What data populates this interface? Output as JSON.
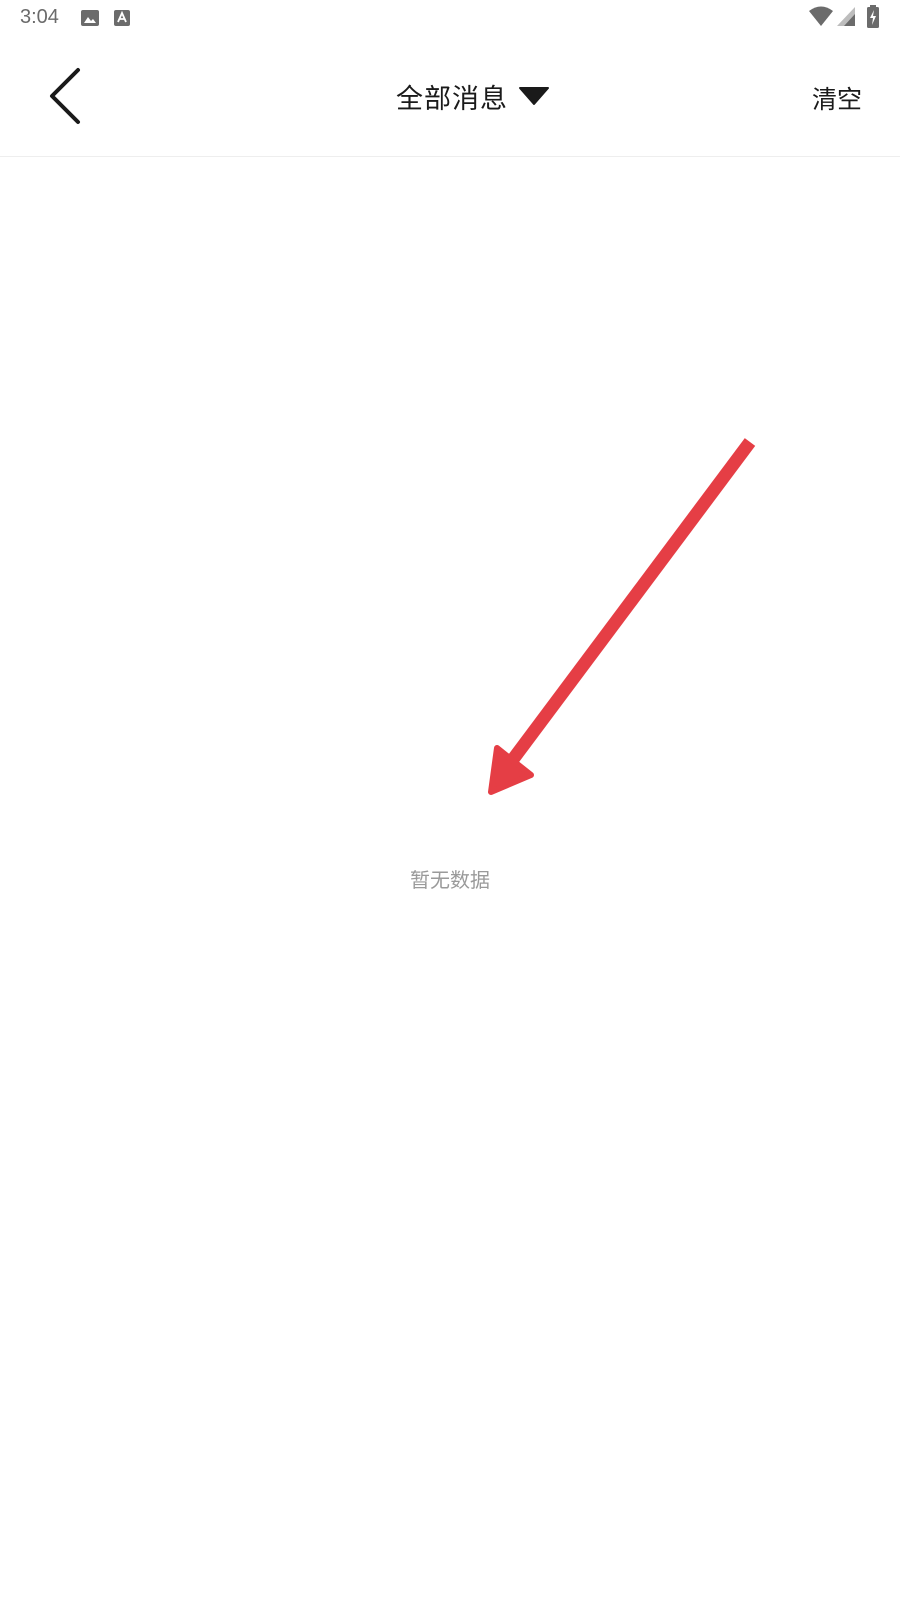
{
  "status_bar": {
    "time": "3:04",
    "icons": [
      "image-notification-icon",
      "text-notification-icon",
      "wifi-icon",
      "cell-signal-icon",
      "battery-charging-icon"
    ]
  },
  "header": {
    "back_icon": "chevron-left-icon",
    "title": "全部消息",
    "title_dropdown_icon": "caret-down-icon",
    "clear_label": "清空"
  },
  "content": {
    "empty_message": "暂无数据"
  },
  "annotation": {
    "arrow_color": "#e53e45"
  },
  "colors": {
    "background": "#ffffff",
    "text_primary": "#1a1a1a",
    "text_muted": "#9a9a9a",
    "status_icons": "#6b6b6b"
  }
}
